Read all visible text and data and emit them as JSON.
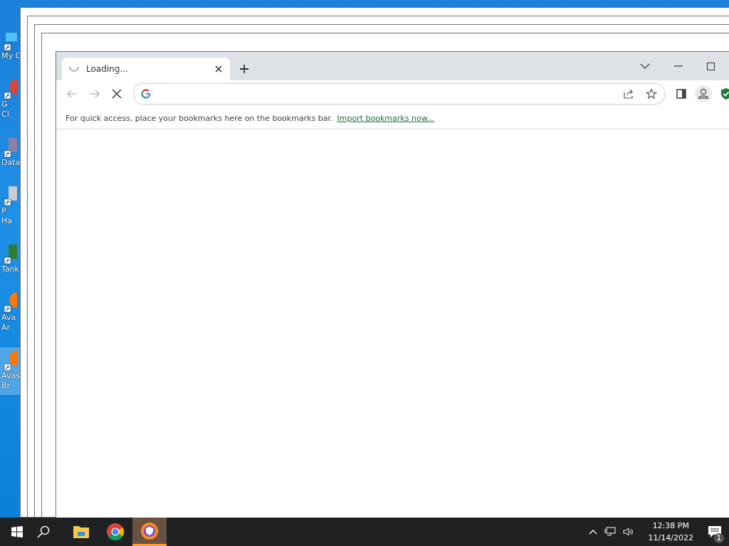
{
  "desktop_icons": [
    {
      "kind": "computer",
      "lines": [
        "My C"
      ],
      "selected": false
    },
    {
      "kind": "chrome",
      "lines": [
        "G",
        "Cl"
      ],
      "selected": false
    },
    {
      "kind": "data",
      "lines": [
        "Data"
      ],
      "selected": false
    },
    {
      "kind": "tool",
      "lines": [
        "P",
        "Ha"
      ],
      "selected": false
    },
    {
      "kind": "tank",
      "lines": [
        "Tank"
      ],
      "selected": false
    },
    {
      "kind": "avast",
      "lines": [
        "Ava",
        "Ar"
      ],
      "selected": false
    },
    {
      "kind": "avast",
      "lines": [
        "Avas",
        "Br"
      ],
      "selected": true
    }
  ],
  "browser": {
    "tabs": [
      {
        "title": "Loading...",
        "selected": true,
        "loading": true
      }
    ],
    "nav": {
      "back_disabled": true,
      "forward_disabled": true,
      "loading": true
    },
    "bookmarks_bar": {
      "message": "For quick access, place your bookmarks here on the bookmarks bar.",
      "link": "Import bookmarks now..."
    }
  },
  "taskbar": {
    "apps": [
      {
        "kind": "explorer",
        "active": false
      },
      {
        "kind": "chrome",
        "active": false
      },
      {
        "kind": "avast",
        "active": true
      }
    ],
    "time": "12:38 PM",
    "date": "11/14/2022",
    "notifications": "1"
  }
}
